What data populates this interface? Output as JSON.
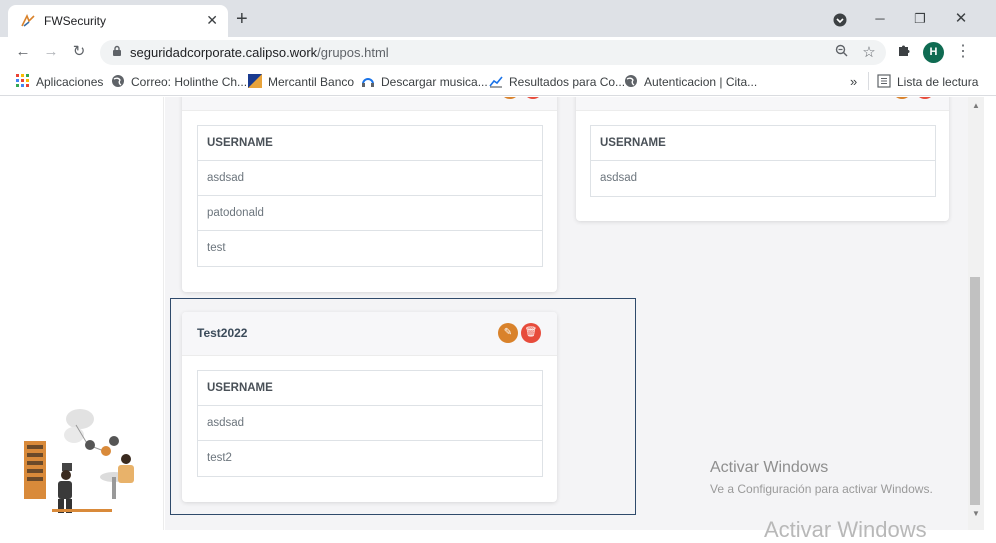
{
  "browser": {
    "tab_title": "FWSecurity",
    "tab_close": "✕",
    "new_tab": "+",
    "url_domain": "seguridadcorporate.calipso.work",
    "url_path": "/grupos.html",
    "profile_initial": "H"
  },
  "bookmarks": {
    "items": [
      {
        "label": "Aplicaciones",
        "icon": "apps-grid-icon"
      },
      {
        "label": "Correo: Holinthe Ch...",
        "icon": "globe-icon"
      },
      {
        "label": "Mercantil Banco",
        "icon": "bank-icon"
      },
      {
        "label": "Descargar musica...",
        "icon": "music-icon"
      },
      {
        "label": "Resultados para Co...",
        "icon": "chart-icon"
      },
      {
        "label": "Autenticacion | Cita...",
        "icon": "globe-icon"
      }
    ],
    "more": "»",
    "reading_list": "Lista de lectura"
  },
  "groups": [
    {
      "title": "",
      "column_header": "USERNAME",
      "users": [
        "asdsad",
        "patodonald",
        "test"
      ]
    },
    {
      "title": "",
      "column_header": "USERNAME",
      "users": [
        "asdsad"
      ]
    },
    {
      "title": "Test2022",
      "column_header": "USERNAME",
      "users": [
        "asdsad",
        "test2"
      ]
    }
  ],
  "watermark": {
    "title": "Activar Windows",
    "subtitle": "Ve a Configuración para activar Windows.",
    "ghost": "Activar Windows"
  },
  "colors": {
    "edit_button": "#d9822b",
    "delete_button": "#e74c3c",
    "selection_border": "#2f4a6b",
    "avatar": "#0f6b52"
  }
}
